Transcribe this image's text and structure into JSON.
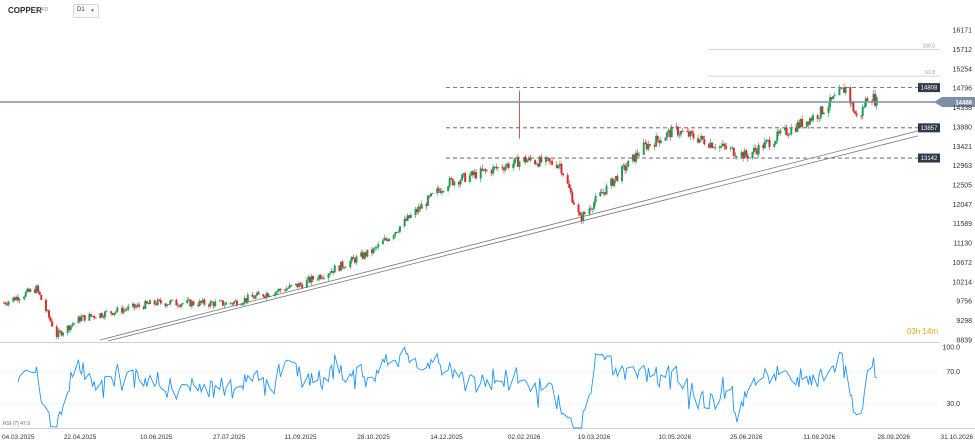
{
  "header": {
    "symbol": "COPPER",
    "symbol_tag": "CFD",
    "timeframe": "D1"
  },
  "price_label": "14468",
  "timer": "03h 14m",
  "rsi_label": "RSI (7) 47.9",
  "colors": {
    "up": "#1f9d55",
    "down": "#d32f2f",
    "rsi": "#2196f3",
    "current_line": "#7f8fa6",
    "level_tag": "#2f3b4c"
  },
  "chart_data": [
    {
      "type": "candlestick",
      "title": "",
      "y_ticks": [
        16171,
        15712,
        15254,
        14796,
        14338,
        13880,
        13421,
        12963,
        12505,
        12047,
        11589,
        11130,
        10672,
        10214,
        9756,
        9298,
        8839
      ],
      "ylim": [
        8839,
        16171
      ],
      "x_tick_labels": [
        "04.03.2025",
        "22.04.2025",
        "10.06.2025",
        "27.07.2025",
        "11.09.2025",
        "28.10.2025",
        "14.12.2025",
        "02.02.2026",
        "19.03.2026",
        "10.05.2026",
        "25.06.2026",
        "11.08.2026",
        "28.09.2026",
        "31.10.2026"
      ],
      "current_price": 14468,
      "horizontal_levels": [
        {
          "label": "14808",
          "value": 14808,
          "style": "dashed"
        },
        {
          "label": "13857",
          "value": 13857,
          "style": "dashed"
        },
        {
          "label": "13142",
          "value": 13142,
          "style": "dashed"
        }
      ],
      "fibonacci_levels": [
        {
          "label": "100.0",
          "value": 15712
        },
        {
          "label": "61.8",
          "value": 15080
        }
      ],
      "trendlines": "two parallel ascending support lines",
      "approx_close_path": [
        {
          "date": "04.03.2025",
          "close": 9720
        },
        {
          "date": "25.03.2025",
          "close": 10050
        },
        {
          "date": "07.04.2025",
          "close": 8950
        },
        {
          "date": "22.04.2025",
          "close": 9350
        },
        {
          "date": "10.06.2025",
          "close": 9720
        },
        {
          "date": "27.07.2025",
          "close": 9700
        },
        {
          "date": "11.09.2025",
          "close": 10150
        },
        {
          "date": "28.10.2025",
          "close": 10950
        },
        {
          "date": "25.11.2025",
          "close": 11900
        },
        {
          "date": "14.12.2025",
          "close": 12550
        },
        {
          "date": "15.01.2026",
          "close": 12900
        },
        {
          "date": "02.02.2026",
          "close": 13100
        },
        {
          "date": "25.02.2026",
          "close": 13000
        },
        {
          "date": "10.03.2026",
          "close": 11700
        },
        {
          "date": "19.03.2026",
          "close": 12100
        },
        {
          "date": "20.04.2026",
          "close": 13400
        },
        {
          "date": "10.05.2026",
          "close": 13800
        },
        {
          "date": "25.06.2026",
          "close": 13200
        },
        {
          "date": "20.07.2026",
          "close": 13750
        },
        {
          "date": "11.08.2026",
          "close": 14200
        },
        {
          "date": "28.08.2026",
          "close": 14800
        },
        {
          "date": "05.09.2026",
          "close": 14000
        },
        {
          "date": "12.09.2026",
          "close": 14700
        },
        {
          "date": "17.09.2026",
          "close": 14468
        }
      ]
    },
    {
      "type": "line",
      "title": "RSI (7) 47.9",
      "y_ticks": [
        100.0,
        70.0,
        30.0
      ],
      "ylim": [
        0,
        100
      ],
      "last_value": 47.9
    }
  ]
}
